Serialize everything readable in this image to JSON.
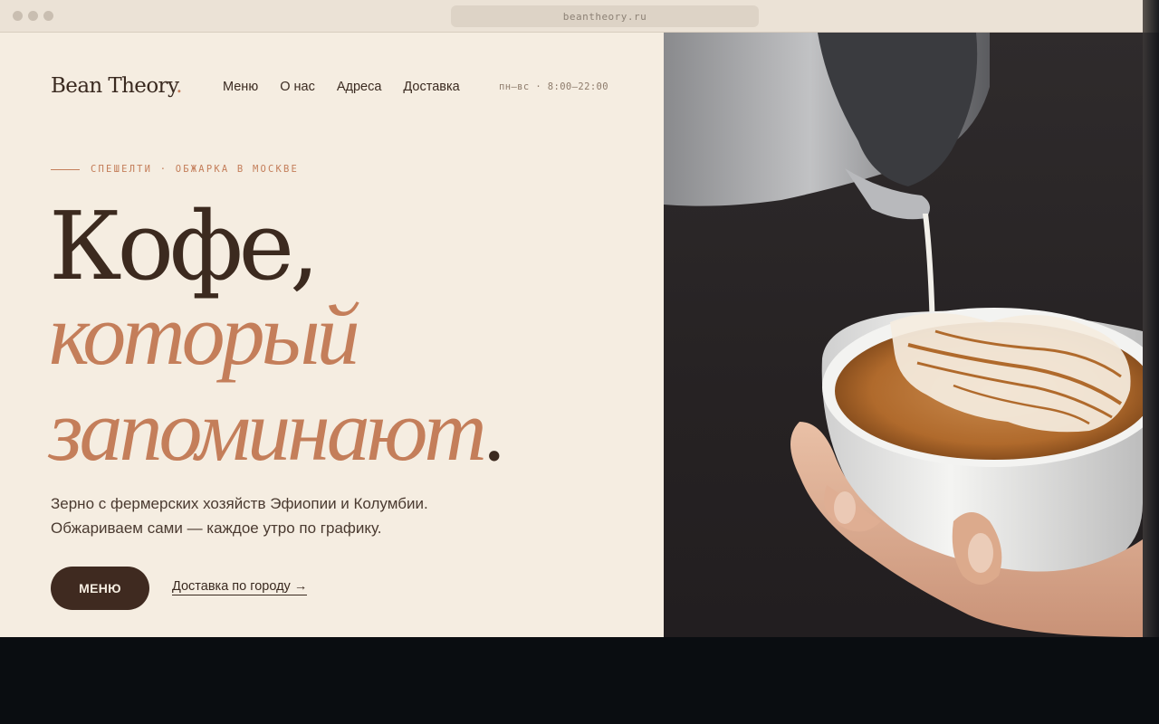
{
  "browser": {
    "url": "beantheory.ru"
  },
  "header": {
    "logo_text": "Bean Theory",
    "logo_dot": ".",
    "nav": [
      {
        "label": "Меню"
      },
      {
        "label": "О нас"
      },
      {
        "label": "Адреса"
      },
      {
        "label": "Доставка"
      }
    ],
    "hours": "пн–вс · 8:00–22:00"
  },
  "hero": {
    "eyebrow": "СПЕШЕЛТИ · ОБЖАРКА В МОСКВЕ",
    "title_line1": "Кофе,",
    "title_line2": "который",
    "title_line3": "запоминают",
    "title_period": ".",
    "subtitle_line1": "Зерно с фермерских хозяйств Эфиопии и Колумбии.",
    "subtitle_line2": "Обжариваем сами — каждое утро по графику.",
    "cta_menu": "МЕНЮ",
    "cta_delivery": "Доставка по городу →"
  },
  "colors": {
    "background": "#f5ede1",
    "accent": "#c47e5a",
    "dark": "#3c2a1f"
  }
}
